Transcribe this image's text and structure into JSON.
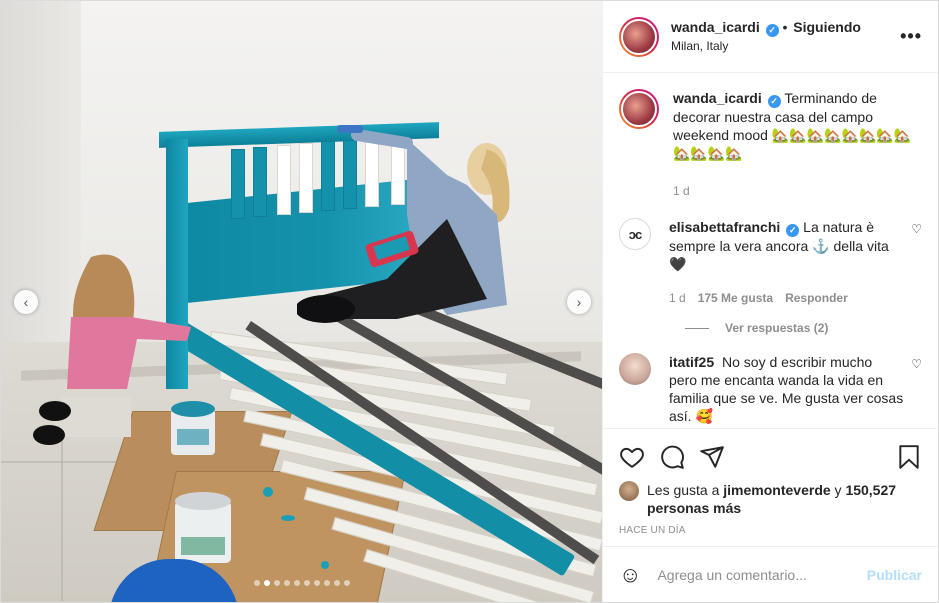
{
  "post": {
    "author": {
      "username": "wanda_icardi",
      "verified": true,
      "follow_status": "Siguiendo",
      "separator": "•",
      "location": "Milan, Italy"
    },
    "more_icon": "more-horizontal-icon",
    "media": {
      "carousel_total": 10,
      "carousel_active": 2,
      "prev_icon": "chevron-left-icon",
      "next_icon": "chevron-right-icon"
    }
  },
  "caption": {
    "username": "wanda_icardi",
    "text": "Terminando de decorar nuestra casa del campo weekend mood 🏡🏡🏡🏡🏡🏡🏡🏡🏡🏡🏡🏡",
    "time": "1 d"
  },
  "comments": [
    {
      "username": "elisabettafranchi",
      "verified": true,
      "text": "La natura è sempre la vera ancora ⚓ della vita 🖤",
      "time": "1 d",
      "likes": "175 Me gusta",
      "reply_label": "Responder",
      "view_replies": "Ver respuestas (2)"
    },
    {
      "username": "itatif25",
      "verified": false,
      "text": "No soy d escribir mucho pero me encanta wanda la vida en familia que se ve. Me gusta ver cosas así. 🥰"
    }
  ],
  "actions": {
    "like_icon": "heart-icon",
    "comment_icon": "comment-icon",
    "share_icon": "share-icon",
    "save_icon": "bookmark-icon"
  },
  "likes": {
    "prefix": "Les gusta a",
    "user": "jimemonteverde",
    "connector": "y",
    "others": "150,527 personas más"
  },
  "posted_time": "HACE UN DÍA",
  "add_comment": {
    "placeholder": "Agrega un comentario...",
    "publish_label": "Publicar",
    "emoji_icon": "emoji-icon"
  },
  "colors": {
    "verified": "#3897f0",
    "publish": "#b2dffc",
    "bed_paint": "#1592ab",
    "muted": "#8e8e8e"
  }
}
